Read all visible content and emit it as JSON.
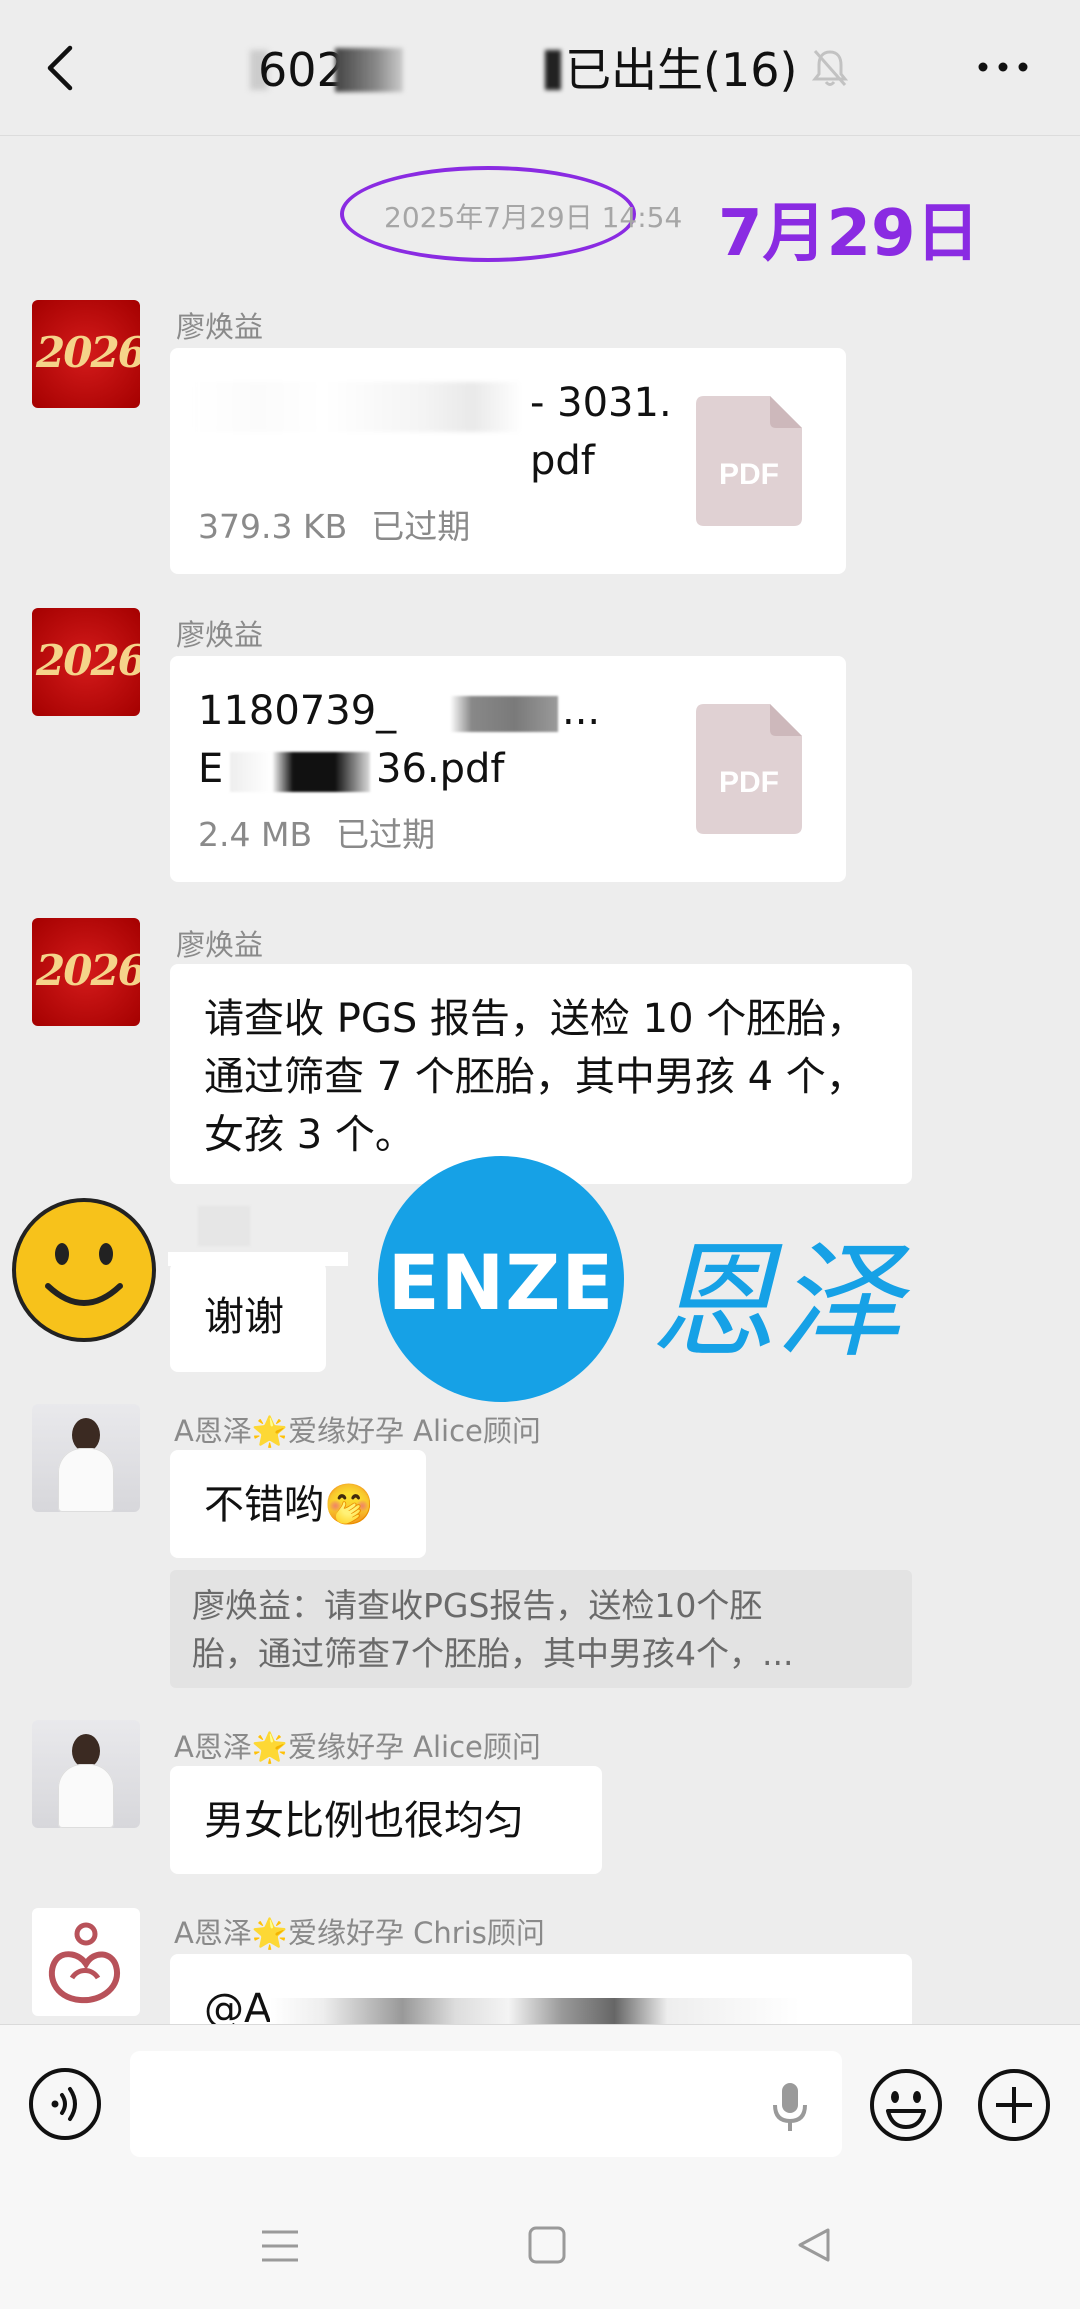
{
  "header": {
    "title_left": "602",
    "title_right": "已出生(16)"
  },
  "timestamp": "2025年7月29日 14:54",
  "annotation_date": "7月29日",
  "messages": [
    {
      "sender": "廖焕益",
      "avatar_text": "2026",
      "file_name": "- 3031.\npdf",
      "file_size": "379.3 KB",
      "file_status": "已过期",
      "file_type": "PDF"
    },
    {
      "sender": "廖焕益",
      "avatar_text": "2026",
      "file_name_line1": "1180739_",
      "file_name_line1_tail": "...",
      "file_name_line2_head": "E",
      "file_name_line2_tail": "36.pdf",
      "file_size": "2.4 MB",
      "file_status": "已过期",
      "file_type": "PDF"
    },
    {
      "sender": "廖焕益",
      "avatar_text": "2026",
      "text": "请查收 PGS 报告，送检 10 个胚胎，\n通过筛查 7 个胚胎，其中男孩 4 个，\n女孩 3 个。"
    },
    {
      "text": "谢谢"
    },
    {
      "sender": "A恩泽🌟爱缘好孕 Alice顾问",
      "text": "不错哟🤭",
      "quote": "廖焕益：请查收PGS报告，送检10个胚\n胎，通过筛查7个胚胎，其中男孩4个，..."
    },
    {
      "sender": "A恩泽🌟爱缘好孕 Alice顾问",
      "text": "男女比例也很均匀"
    },
    {
      "sender": "A恩泽🌟爱缘好孕 Chris顾问",
      "text": "@A"
    }
  ],
  "watermark": {
    "logo_text": "ENZE",
    "cn_text": "恩泽"
  },
  "colors": {
    "annotation": "#8a2be2",
    "brand": "#16a1e6",
    "background": "#ededed"
  }
}
